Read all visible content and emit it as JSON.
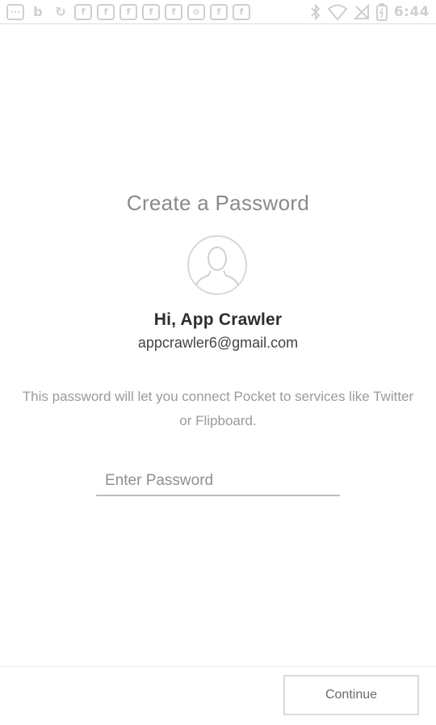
{
  "status_bar": {
    "notification_icons": [
      "more-icon",
      "b-app-icon",
      "sync-icon",
      "facebook-icon",
      "facebook-icon",
      "facebook-icon",
      "facebook-icon",
      "facebook-icon",
      "car-icon",
      "facebook-icon",
      "facebook-icon"
    ],
    "system_icons": [
      "bluetooth-icon",
      "wifi-icon",
      "no-signal-icon",
      "battery-charging-icon"
    ],
    "time": "6:44"
  },
  "screen": {
    "title": "Create a Password",
    "greeting": "Hi, App Crawler",
    "email": "appcrawler6@gmail.com",
    "description": "This password will let you connect Pocket to services like Twitter or Flipboard.",
    "password_placeholder": "Enter Password",
    "password_value": ""
  },
  "footer": {
    "continue_label": "Continue"
  }
}
